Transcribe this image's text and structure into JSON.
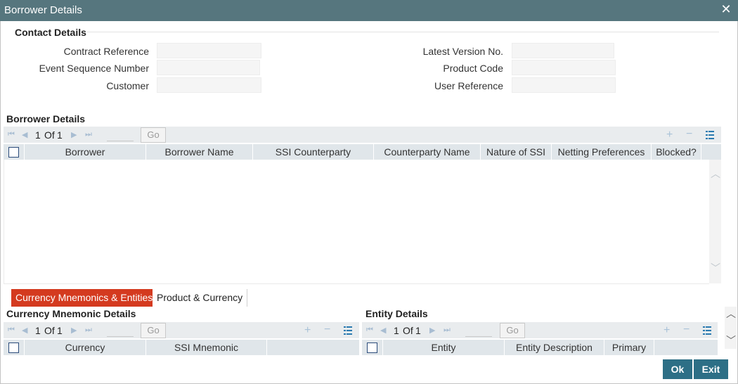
{
  "window": {
    "title": "Borrower Details",
    "close_glyph": "✕"
  },
  "contact": {
    "title": "Contact Details",
    "contract_reference_label": "Contract Reference",
    "event_sequence_label": "Event Sequence Number",
    "customer_label": "Customer",
    "latest_version_label": "Latest Version No.",
    "product_code_label": "Product Code",
    "user_reference_label": "User Reference"
  },
  "borrower": {
    "title": "Borrower Details",
    "pager": {
      "current": "1",
      "of": "Of",
      "total": "1",
      "go": "Go"
    },
    "columns": [
      "Borrower",
      "Borrower Name",
      "SSI Counterparty",
      "Counterparty Name",
      "Nature of SSI",
      "Netting Preferences",
      "Blocked?"
    ]
  },
  "tabs": {
    "active": "Currency Mnemonics & Entities",
    "inactive": "Product & Currency"
  },
  "currency": {
    "title": "Currency Mnemonic Details",
    "pager": {
      "current": "1",
      "of": "Of",
      "total": "1",
      "go": "Go"
    },
    "columns": [
      "Currency",
      "SSI Mnemonic"
    ]
  },
  "entity": {
    "title": "Entity Details",
    "pager": {
      "current": "1",
      "of": "Of",
      "total": "1",
      "go": "Go"
    },
    "columns": [
      "Entity",
      "Entity Description",
      "Primary"
    ]
  },
  "footer": {
    "ok": "Ok",
    "exit": "Exit"
  },
  "icons": {
    "first": "first-page-icon",
    "prev": "prev-page-icon",
    "next": "next-page-icon",
    "last": "last-page-icon",
    "add": "add-row-icon",
    "delete": "delete-row-icon",
    "view": "single-view-icon"
  },
  "colors": {
    "titlebar": "#56767e",
    "active_tab": "#d43a1f",
    "button": "#2d6f86"
  }
}
